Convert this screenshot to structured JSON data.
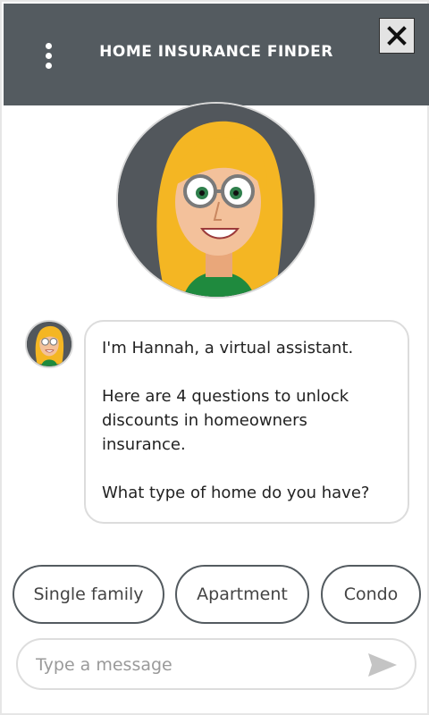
{
  "header": {
    "title": "Home Insurance Finder",
    "menu_icon": "kebab-menu-icon",
    "close_icon": "close-x-icon",
    "bg_color": "#545b60"
  },
  "assistant": {
    "avatar_icon": "hannah-avatar-illustration"
  },
  "message": {
    "line1": "I'm Hannah, a virtual assistant.",
    "line2": "Here are 4 questions to unlock discounts in homeowners insurance.",
    "line3": "What type of home do you have?"
  },
  "quick_replies": [
    {
      "label": "Single family"
    },
    {
      "label": "Apartment"
    },
    {
      "label": "Condo"
    }
  ],
  "composer": {
    "placeholder": "Type a message",
    "value": "",
    "send_icon": "send-arrow-icon"
  }
}
